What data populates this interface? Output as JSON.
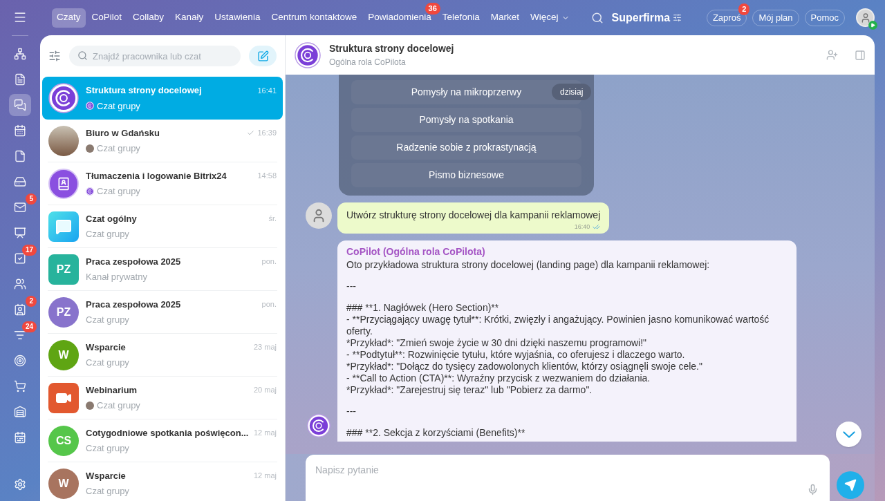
{
  "rail": {
    "items": [
      {
        "selected": false
      },
      {
        "selected": false
      },
      {
        "selected": true
      },
      {
        "selected": false
      },
      {
        "selected": false
      },
      {
        "selected": false
      },
      {
        "selected": false,
        "badge": "5"
      },
      {
        "selected": false
      },
      {
        "selected": false,
        "badge": "17"
      },
      {
        "selected": false
      },
      {
        "selected": false,
        "badge": "2"
      },
      {
        "selected": false,
        "badge": "24"
      },
      {
        "selected": false
      },
      {
        "selected": false
      },
      {
        "selected": false
      },
      {
        "selected": false
      }
    ]
  },
  "nav": {
    "tabs": [
      {
        "label": "Czaty",
        "selected": true
      },
      {
        "label": "CoPilot",
        "selected": false
      },
      {
        "label": "Collaby",
        "selected": false
      },
      {
        "label": "Kanały",
        "selected": false
      },
      {
        "label": "Ustawienia",
        "selected": false
      },
      {
        "label": "Centrum kontaktowe",
        "selected": false
      },
      {
        "label": "Powiadomienia",
        "selected": false,
        "badge": "36"
      },
      {
        "label": "Telefonia",
        "selected": false
      },
      {
        "label": "Market",
        "selected": false
      },
      {
        "label": "Więcej",
        "selected": false,
        "menu": true
      }
    ],
    "brand": "Superfirma",
    "buttons": [
      {
        "label": "Zaproś",
        "badge": "2"
      },
      {
        "label": "Mój plan"
      },
      {
        "label": "Pomoc"
      }
    ]
  },
  "chat_list": {
    "search": {
      "placeholder": "Znajdź pracownika lub czat"
    },
    "items": [
      {
        "name": "Struktura strony docelowej",
        "time": "16:41",
        "subtitle": "Czat grupy",
        "avatar": {
          "kind": "copilot"
        },
        "sub_avatar": {
          "kind": "copilot"
        },
        "delivered": false,
        "selected": true
      },
      {
        "name": "Biuro w Gdańsku",
        "time": "16:39",
        "subtitle": "Czat grupy",
        "avatar": {
          "kind": "photo"
        },
        "sub_avatar": {
          "kind": "person"
        },
        "delivered": true,
        "selected": false
      },
      {
        "name": "Tłumaczenia i logowanie Bitrix24",
        "time": "14:58",
        "subtitle": "Czat grupy",
        "avatar": {
          "kind": "book"
        },
        "sub_avatar": {
          "kind": "copilot"
        },
        "delivered": false,
        "selected": false
      },
      {
        "name": "Czat ogólny",
        "time": "śr.",
        "subtitle": "Czat grupy",
        "avatar": {
          "kind": "bubbles"
        },
        "delivered": false,
        "selected": false
      },
      {
        "name": "Praca zespołowa 2025",
        "time": "pon.",
        "subtitle": "Kanał prywatny",
        "avatar": {
          "kind": "initials_square",
          "initials": "PZ",
          "color": "#27b39c"
        },
        "delivered": false,
        "selected": false
      },
      {
        "name": "Praca zespołowa 2025",
        "time": "pon.",
        "subtitle": "Czat grupy",
        "avatar": {
          "kind": "initials_circle",
          "initials": "PZ",
          "color": "#8873cc"
        },
        "delivered": false,
        "selected": false
      },
      {
        "name": "Wsparcie",
        "time": "23 maj",
        "subtitle": "Czat grupy",
        "avatar": {
          "kind": "initials_circle",
          "initials": "W",
          "color": "#5fa513"
        },
        "delivered": false,
        "selected": false
      },
      {
        "name": "Webinarium",
        "time": "20 maj",
        "subtitle": "Czat grupy",
        "avatar": {
          "kind": "video"
        },
        "sub_avatar": {
          "kind": "person"
        },
        "delivered": false,
        "selected": false
      },
      {
        "name": "Cotygodniowe spotkania poświęcon...",
        "time": "12 maj",
        "subtitle": "Czat grupy",
        "avatar": {
          "kind": "initials_circle",
          "initials": "CS",
          "color": "#55c64a"
        },
        "delivered": false,
        "selected": false
      },
      {
        "name": "Wsparcie",
        "time": "12 maj",
        "subtitle": "Czat grupy",
        "avatar": {
          "kind": "initials_circle",
          "initials": "W",
          "color": "#a8745f"
        },
        "delivered": false,
        "selected": false
      }
    ]
  },
  "chat": {
    "title": "Struktura strony docelowej",
    "subtitle": "Ogólna rola CoPilota",
    "date_pill": "dzisiaj",
    "options": [
      "Pomysły na mikroprzerwy",
      "Pomysły na spotkania",
      "Radzenie sobie z prokrastynacją",
      "Pismo biznesowe"
    ],
    "user_message": {
      "text": "Utwórz strukturę strony docelowej dla kampanii reklamowej",
      "time": "16:40",
      "read": true
    },
    "bot_message": {
      "author": "CoPilot (Ogólna rola CoPilota)",
      "blocks": [
        [
          "Oto przykładowa struktura strony docelowej (landing page) dla kampanii reklamowej:"
        ],
        [
          "---"
        ],
        [
          "### **1. Nagłówek (Hero Section)**",
          "- **Przyciągający uwagę tytuł**: Krótki, zwięzły i angażujący. Powinien jasno komunikować wartość oferty.",
          "*Przykład*: \"Zmień swoje życie w 30 dni dzięki naszemu programowi!\"",
          "- **Podtytuł**: Rozwinięcie tytułu, które wyjaśnia, co oferujesz i dlaczego warto.",
          "*Przykład*: \"Dołącz do tysięcy zadowolonych klientów, którzy osiągnęli swoje cele.\"",
          "- **Call to Action (CTA)**: Wyraźny przycisk z wezwaniem do działania.",
          "*Przykład*: \"Zarejestruj się teraz\" lub \"Pobierz za darmo\"."
        ],
        [
          "---"
        ],
        [
          "### **2. Sekcja z korzyściami (Benefits)**"
        ]
      ]
    },
    "input": {
      "placeholder": "Napisz pytanie"
    }
  }
}
